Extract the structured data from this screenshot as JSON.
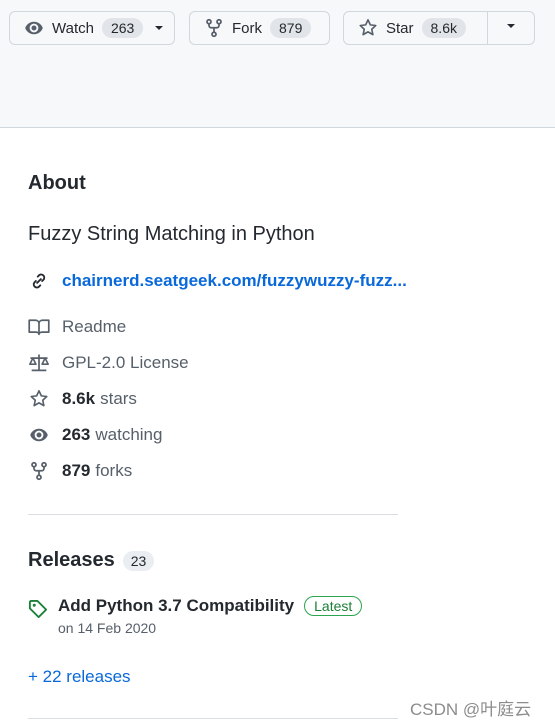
{
  "actions": {
    "watch": {
      "label": "Watch",
      "count": "263"
    },
    "fork": {
      "label": "Fork",
      "count": "879"
    },
    "star": {
      "label": "Star",
      "count": "8.6k"
    }
  },
  "about": {
    "heading": "About",
    "description": "Fuzzy String Matching in Python",
    "link": "chairnerd.seatgeek.com/fuzzywuzzy-fuzz...",
    "readme": "Readme",
    "license": "GPL-2.0 License",
    "stars_count": "8.6k",
    "stars_label": "stars",
    "watching_count": "263",
    "watching_label": "watching",
    "forks_count": "879",
    "forks_label": "forks"
  },
  "releases": {
    "heading": "Releases",
    "count": "23",
    "latest_title": "Add Python 3.7 Compatibility",
    "latest_badge": "Latest",
    "latest_date": "on 14 Feb 2020",
    "more_link": "+ 22 releases"
  },
  "watermark": "CSDN @叶庭云",
  "colors": {
    "link": "#0969da",
    "latest_badge": "#1a7f37",
    "tag_icon": "#1a7f37"
  }
}
